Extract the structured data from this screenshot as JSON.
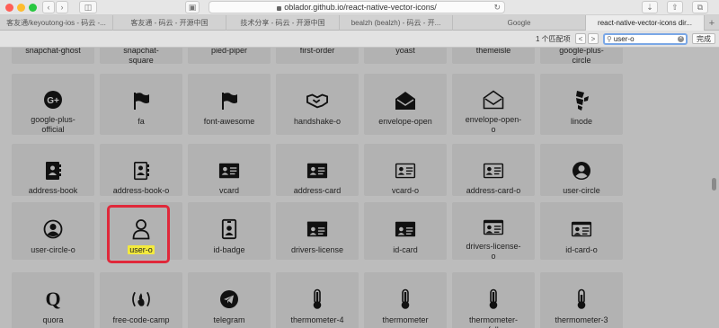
{
  "browser": {
    "url": "oblador.github.io/react-native-vector-icons/",
    "tabs": [
      {
        "label": "客友通/keyoutong-ios - 码云 -...",
        "active": false
      },
      {
        "label": "客友通 - 码云 - 开源中国",
        "active": false
      },
      {
        "label": "技术分享 - 码云 - 开源中国",
        "active": false
      },
      {
        "label": "bealzh (bealzh) - 码云 - 开...",
        "active": false
      },
      {
        "label": "Google",
        "active": false
      },
      {
        "label": "react-native-vector-icons dir...",
        "active": true
      }
    ]
  },
  "find": {
    "count": "1 个匹配项",
    "query": "user-o",
    "done_label": "完成",
    "prev": "<",
    "next": ">"
  },
  "icons": {
    "top_row": [
      "snapchat-ghost",
      "snapchat-\nsquare",
      "pied-piper",
      "first-order",
      "yoast",
      "themeisle",
      "google-plus-\ncircle"
    ],
    "row1": [
      {
        "label": "google-plus-\nofficial",
        "icon": "google-plus-icon"
      },
      {
        "label": "fa",
        "icon": "flag-icon"
      },
      {
        "label": "font-awesome",
        "icon": "flag-icon"
      },
      {
        "label": "handshake-o",
        "icon": "handshake-icon"
      },
      {
        "label": "envelope-open",
        "icon": "envelope-open-icon"
      },
      {
        "label": "envelope-open-\no",
        "icon": "envelope-open-outline-icon"
      },
      {
        "label": "linode",
        "icon": "linode-icon"
      }
    ],
    "row2": [
      {
        "label": "address-book",
        "icon": "address-book-icon"
      },
      {
        "label": "address-book-o",
        "icon": "address-book-outline-icon"
      },
      {
        "label": "vcard",
        "icon": "vcard-icon"
      },
      {
        "label": "address-card",
        "icon": "address-card-icon"
      },
      {
        "label": "vcard-o",
        "icon": "vcard-outline-icon"
      },
      {
        "label": "address-card-o",
        "icon": "address-card-outline-icon"
      },
      {
        "label": "user-circle",
        "icon": "user-circle-icon"
      }
    ],
    "row3": [
      {
        "label": "user-circle-o",
        "icon": "user-circle-outline-icon"
      },
      {
        "label": "user-o",
        "icon": "user-outline-icon"
      },
      {
        "label": "id-badge",
        "icon": "id-badge-icon"
      },
      {
        "label": "drivers-license",
        "icon": "drivers-license-icon"
      },
      {
        "label": "id-card",
        "icon": "id-card-icon"
      },
      {
        "label": "drivers-license-\no",
        "icon": "drivers-license-outline-icon"
      },
      {
        "label": "id-card-o",
        "icon": "id-card-outline-icon"
      }
    ],
    "row4": [
      {
        "label": "quora",
        "icon": "quora-icon"
      },
      {
        "label": "free-code-camp",
        "icon": "free-code-camp-icon"
      },
      {
        "label": "telegram",
        "icon": "telegram-icon"
      },
      {
        "label": "thermometer-4",
        "icon": "thermometer-icon"
      },
      {
        "label": "thermometer",
        "icon": "thermometer-icon"
      },
      {
        "label": "thermometer-\nfull",
        "icon": "thermometer-icon"
      },
      {
        "label": "thermometer-3",
        "icon": "thermometer-icon"
      }
    ]
  },
  "colors": {
    "highlight": "#f3ea3d",
    "match_box": "#e0283a"
  }
}
